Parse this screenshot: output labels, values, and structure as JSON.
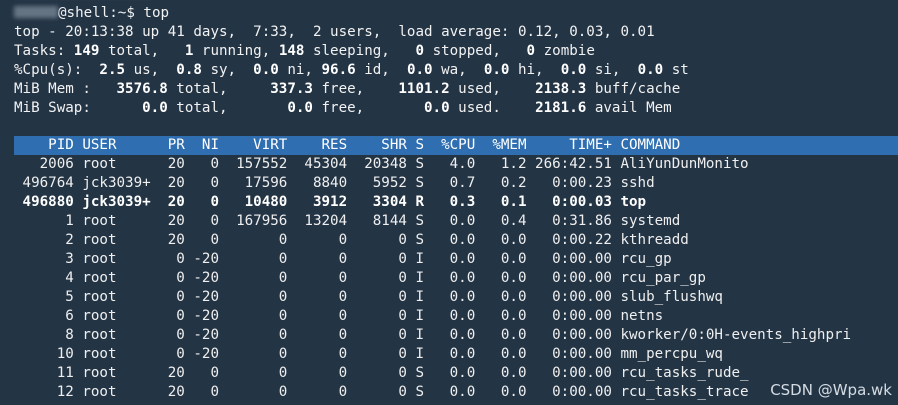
{
  "terminal": {
    "prompt_host": "@shell:~$ top",
    "summary": {
      "uptime_line": "top - 20:13:38 up 41 days,  7:33,  2 users,  load average: 0.12, 0.03, 0.01",
      "tasks_label": "Tasks: ",
      "tasks_total": "149",
      "tasks_total_label": " total,   ",
      "tasks_running": "1",
      "tasks_running_label": " running, ",
      "tasks_sleeping": "148",
      "tasks_sleeping_label": " sleeping,   ",
      "tasks_stopped": "0",
      "tasks_stopped_label": " stopped,   ",
      "tasks_zombie": "0",
      "tasks_zombie_label": " zombie",
      "cpu_label": "%Cpu(s):  ",
      "cpu_us": "2.5",
      "cpu_us_label": " us,  ",
      "cpu_sy": "0.8",
      "cpu_sy_label": " sy,  ",
      "cpu_ni": "0.0",
      "cpu_ni_label": " ni, ",
      "cpu_id": "96.6",
      "cpu_id_label": " id,  ",
      "cpu_wa": "0.0",
      "cpu_wa_label": " wa,  ",
      "cpu_hi": "0.0",
      "cpu_hi_label": " hi,  ",
      "cpu_si": "0.0",
      "cpu_si_label": " si,  ",
      "cpu_st": "0.0",
      "cpu_st_label": " st",
      "mem_label": "MiB Mem :   ",
      "mem_total": "3576.8",
      "mem_total_label": " total,     ",
      "mem_free": "337.3",
      "mem_free_label": " free,    ",
      "mem_used": "1101.2",
      "mem_used_label": " used,    ",
      "mem_cache": "2138.3",
      "mem_cache_label": " buff/cache",
      "swap_label": "MiB Swap:      ",
      "swap_total": "0.0",
      "swap_total_label": " total,       ",
      "swap_free": "0.0",
      "swap_free_label": " free,       ",
      "swap_used": "0.0",
      "swap_used_label": " used.    ",
      "swap_avail": "2181.6",
      "swap_avail_label": " avail Mem"
    },
    "columns_header": "    PID USER      PR  NI    VIRT    RES    SHR S  %CPU  %MEM     TIME+ COMMAND",
    "processes": [
      {
        "text": "   2006 root      20   0  157552  45304  20348 S   4.0   1.2 266:42.51 AliYunDunMonito",
        "bold": false
      },
      {
        "text": " 496764 jck3039+  20   0   17596   8840   5952 S   0.7   0.2   0:00.23 sshd",
        "bold": false
      },
      {
        "text": " 496880 jck3039+  20   0   10480   3912   3304 R   0.3   0.1   0:00.03 top",
        "bold": true
      },
      {
        "text": "      1 root      20   0  167956  13204   8144 S   0.0   0.4   0:31.86 systemd",
        "bold": false
      },
      {
        "text": "      2 root      20   0       0      0      0 S   0.0   0.0   0:00.22 kthreadd",
        "bold": false
      },
      {
        "text": "      3 root       0 -20       0      0      0 I   0.0   0.0   0:00.00 rcu_gp",
        "bold": false
      },
      {
        "text": "      4 root       0 -20       0      0      0 I   0.0   0.0   0:00.00 rcu_par_gp",
        "bold": false
      },
      {
        "text": "      5 root       0 -20       0      0      0 I   0.0   0.0   0:00.00 slub_flushwq",
        "bold": false
      },
      {
        "text": "      6 root       0 -20       0      0      0 I   0.0   0.0   0:00.00 netns",
        "bold": false
      },
      {
        "text": "      8 root       0 -20       0      0      0 I   0.0   0.0   0:00.00 kworker/0:0H-events_highpri",
        "bold": false
      },
      {
        "text": "     10 root       0 -20       0      0      0 I   0.0   0.0   0:00.00 mm_percpu_wq",
        "bold": false
      },
      {
        "text": "     11 root      20   0       0      0      0 S   0.0   0.0   0:00.00 rcu_tasks_rude_",
        "bold": false
      },
      {
        "text": "     12 root      20   0       0      0      0 S   0.0   0.0   0:00.00 rcu_tasks_trace",
        "bold": false
      }
    ]
  },
  "watermark": "CSDN @Wpa.wk",
  "colors": {
    "background": "#233445",
    "header_bar": "#2f6fb1",
    "text": "#efefef"
  }
}
